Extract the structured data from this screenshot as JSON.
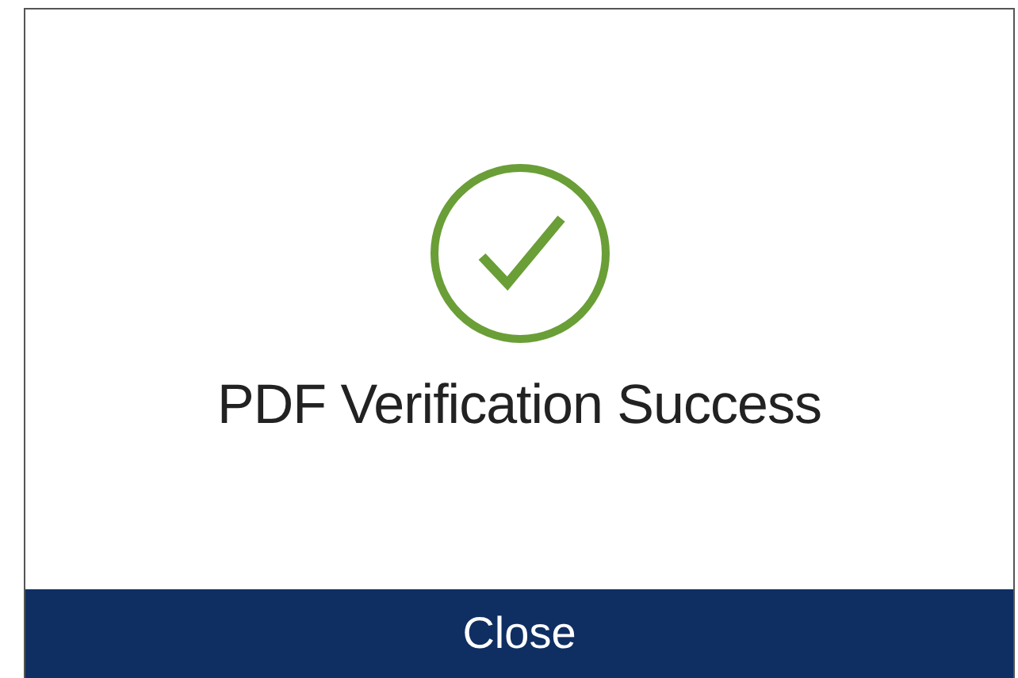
{
  "dialog": {
    "message": "PDF Verification Success",
    "verified": true,
    "button": "Close"
  }
}
